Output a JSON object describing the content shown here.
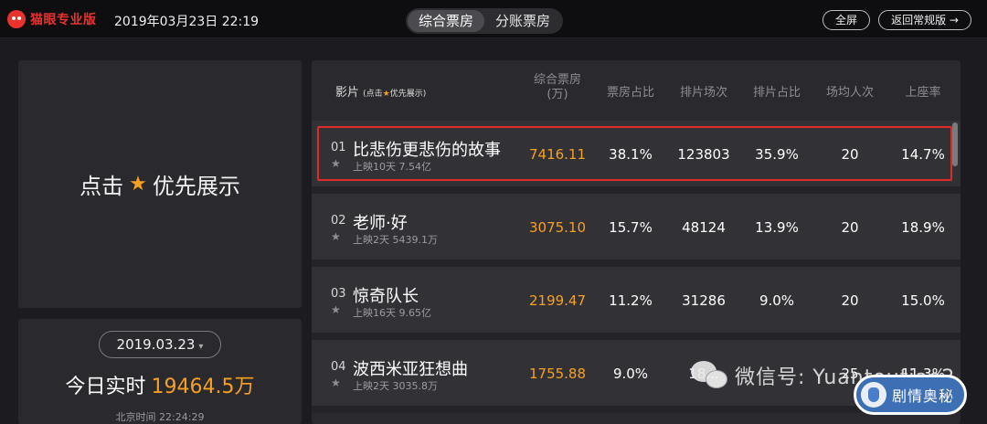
{
  "app": {
    "logo_text": "猫眼专业版",
    "datetime": "2019年03月23日 22:19"
  },
  "tabs": [
    {
      "label": "综合票房",
      "active": true
    },
    {
      "label": "分账票房",
      "active": false
    }
  ],
  "buttons": {
    "fullscreen": "全屏",
    "back": "返回常规版 →"
  },
  "promo": {
    "prefix": "点击",
    "star": "★",
    "suffix": "优先展示"
  },
  "today": {
    "date": "2019.03.23",
    "caret": "▾",
    "label": "今日实时",
    "value": "19464.5万",
    "beijing_time": "北京时间 22:24:29"
  },
  "table": {
    "headers": {
      "film": "影片",
      "film_hint_prefix": "(点击",
      "film_hint_star": "★",
      "film_hint_suffix": "优先展示)",
      "box": "综合票房\n(万)",
      "box_share": "票房占比",
      "sessions": "排片场次",
      "session_share": "排片占比",
      "avg_viewers": "场均人次",
      "occupancy": "上座率"
    },
    "rows": [
      {
        "rank": "01",
        "title": "比悲伤更悲伤的故事",
        "meta": "上映10天  7.54亿",
        "box": "7416.11",
        "box_share": "38.1%",
        "sessions": "123803",
        "session_share": "35.9%",
        "avg": "20",
        "occupancy": "14.7%"
      },
      {
        "rank": "02",
        "title": "老师·好",
        "meta": "上映2天  5439.1万",
        "box": "3075.10",
        "box_share": "15.7%",
        "sessions": "48124",
        "session_share": "13.9%",
        "avg": "20",
        "occupancy": "18.9%"
      },
      {
        "rank": "03",
        "title": "惊奇队长",
        "meta": "上映16天  9.65亿",
        "box": "2199.47",
        "box_share": "11.2%",
        "sessions": "31286",
        "session_share": "9.0%",
        "avg": "20",
        "occupancy": "15.0%"
      },
      {
        "rank": "04",
        "title": "波西米亚狂想曲",
        "meta": "上映2天  3035.8万",
        "box": "1755.88",
        "box_share": "9.0%",
        "sessions": "18...",
        "session_share": "",
        "avg": "25",
        "occupancy": "11.3%"
      }
    ]
  },
  "watermark": {
    "wechat": "微信号: Yuantoutiao2",
    "badge": "剧情奥秘"
  }
}
